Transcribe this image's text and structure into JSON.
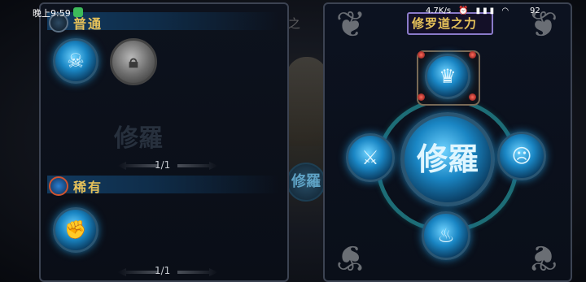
{
  "status_bar": {
    "time": "晚上9:59",
    "network_speed": "4.7K/s",
    "status_icons": "⏰ ▮▮▮ ◠",
    "battery": "92"
  },
  "background": {
    "title_fragment": "修罗道之",
    "seal_glyph": "修羅"
  },
  "left_panel": {
    "common_section": {
      "title": "普通",
      "skills": [
        {
          "name": "demon-face-skill",
          "state": "unlocked"
        },
        {
          "name": "locked-skill",
          "state": "locked"
        }
      ],
      "page_indicator": "1/1"
    },
    "rare_section": {
      "title": "稀有",
      "skills": [
        {
          "name": "fist-skill",
          "state": "unlocked"
        }
      ],
      "page_indicator": "1/1"
    },
    "watermark_glyph": "修羅"
  },
  "right_panel": {
    "title": "修罗道之力",
    "center_glyph": "修羅",
    "nodes": [
      "top-demon-helm",
      "left-strike",
      "right-scream",
      "bottom-flame-claw"
    ]
  },
  "colors": {
    "accent_gold": "#e8c35a",
    "orb_blue": "#1a86c4",
    "ring_teal": "#1d6d76",
    "panel_border": "#3c4352"
  }
}
